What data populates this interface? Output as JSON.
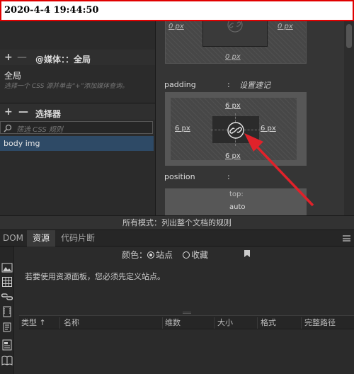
{
  "timestamp": "2020-4-4 19:44:50",
  "css_panel": {
    "media_plus": "+",
    "media_minus": "—",
    "media_label": "@媒体：：全局",
    "global_label": "全局",
    "hint": "选择一个 CSS 源并单击“+”添加媒体查询。",
    "sel_plus": "+",
    "sel_minus": "—",
    "selector_label": "选择器",
    "filter_placeholder": "筛选 CSS 规则",
    "selected_rule": "body img"
  },
  "props": {
    "margin_left": "0 px",
    "margin_right": "0 px",
    "margin_bottom": "0 px",
    "padding_label": "padding",
    "padding_colon": ":",
    "padding_shorthand": "设置速记",
    "padding_top": "6 px",
    "padding_left": "6 px",
    "padding_right": "6 px",
    "padding_bottom": "6 px",
    "position_label": "position",
    "position_colon": ":",
    "top_label": "top:",
    "top_value": "auto"
  },
  "status_text": "所有模式：列出整个文档的规则",
  "tabs": [
    "DOM",
    "资源",
    "代码片断"
  ],
  "assets": {
    "color_label": "颜色：",
    "opt_site": "站点",
    "opt_fav": "收藏",
    "message": "若要使用资源面板，您必须先定义站点。",
    "columns": [
      "类型 ↑",
      "名称",
      "维数",
      "大小",
      "格式",
      "完整路径"
    ]
  },
  "colors": {
    "arrow": "#e0222a",
    "selected_row": "#2e4a66",
    "timestamp_border": "#e00000"
  }
}
